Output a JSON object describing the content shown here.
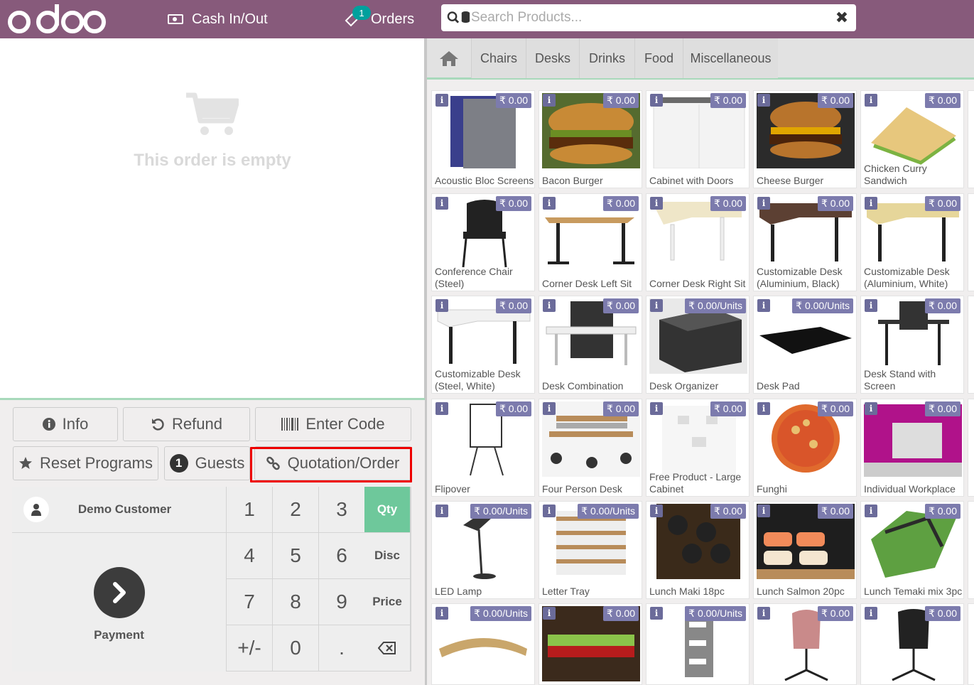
{
  "header": {
    "logo_text": "odoo",
    "cash_label": "Cash In/Out",
    "orders_label": "Orders",
    "orders_badge": "1",
    "search_placeholder": "Search Products...",
    "clear_icon": "close-icon"
  },
  "order": {
    "empty_text": "This order is empty"
  },
  "controls": {
    "info": "Info",
    "refund": "Refund",
    "enter_code": "Enter Code",
    "reset_programs": "Reset Programs",
    "guests_count": "1",
    "guests": "Guests",
    "quotation": "Quotation/Order"
  },
  "pad": {
    "customer": "Demo Customer",
    "payment": "Payment",
    "keys": [
      "1",
      "2",
      "3",
      "4",
      "5",
      "6",
      "7",
      "8",
      "9",
      "+/-",
      "0",
      "."
    ],
    "modes": [
      "Qty",
      "Disc",
      "Price"
    ],
    "active_mode": "Qty"
  },
  "categories": [
    "Chairs",
    "Desks",
    "Drinks",
    "Food",
    "Miscellaneous"
  ],
  "products": [
    {
      "name": "Acoustic Bloc Screens",
      "price": "₹ 0.00"
    },
    {
      "name": "Bacon Burger",
      "price": "₹ 0.00"
    },
    {
      "name": "Cabinet with Doors",
      "price": "₹ 0.00"
    },
    {
      "name": "Cheese Burger",
      "price": "₹ 0.00"
    },
    {
      "name": "Chicken Curry Sandwich",
      "price": "₹ 0.00"
    },
    {
      "name": "Conference Chair (Steel)",
      "price": "₹ 0.00"
    },
    {
      "name": "Corner Desk Left Sit",
      "price": "₹ 0.00"
    },
    {
      "name": "Corner Desk Right Sit",
      "price": "₹ 0.00"
    },
    {
      "name": "Customizable Desk (Aluminium, Black)",
      "price": "₹ 0.00"
    },
    {
      "name": "Customizable Desk (Aluminium, White)",
      "price": "₹ 0.00"
    },
    {
      "name": "Customizable Desk (Steel, White)",
      "price": "₹ 0.00"
    },
    {
      "name": "Desk Combination",
      "price": "₹ 0.00"
    },
    {
      "name": "Desk Organizer",
      "price": "₹ 0.00/Units"
    },
    {
      "name": "Desk Pad",
      "price": "₹ 0.00/Units"
    },
    {
      "name": "Desk Stand with Screen",
      "price": "₹ 0.00"
    },
    {
      "name": "Flipover",
      "price": "₹ 0.00"
    },
    {
      "name": "Four Person Desk",
      "price": "₹ 0.00"
    },
    {
      "name": "Free Product - Large Cabinet",
      "price": "₹ 0.00"
    },
    {
      "name": "Funghi",
      "price": "₹ 0.00"
    },
    {
      "name": "Individual Workplace",
      "price": "₹ 0.00"
    },
    {
      "name": "LED Lamp",
      "price": "₹ 0.00/Units"
    },
    {
      "name": "Letter Tray",
      "price": "₹ 0.00/Units"
    },
    {
      "name": "Lunch Maki 18pc",
      "price": "₹ 0.00"
    },
    {
      "name": "Lunch Salmon 20pc",
      "price": "₹ 0.00"
    },
    {
      "name": "Lunch Temaki mix 3pc",
      "price": "₹ 0.00"
    },
    {
      "name": "",
      "price": "₹ 0.00/Units"
    },
    {
      "name": "",
      "price": "₹ 0.00"
    },
    {
      "name": "",
      "price": "₹ 0.00/Units"
    },
    {
      "name": "",
      "price": "₹ 0.00"
    },
    {
      "name": "",
      "price": "₹ 0.00"
    }
  ],
  "colors": {
    "header": "#875a7b",
    "active_mode": "#6ec89b",
    "price_badge": "#7c7bad",
    "highlight": "#ee0000"
  }
}
